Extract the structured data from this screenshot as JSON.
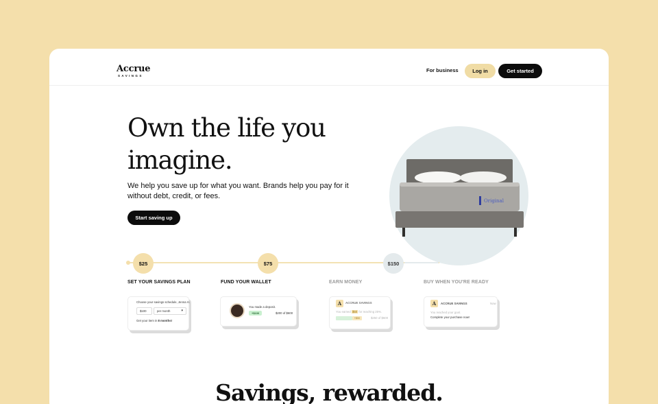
{
  "brand": {
    "name": "Accrue",
    "sub": "SAVINGS"
  },
  "nav": {
    "business": "For business",
    "login": "Log in",
    "get_started": "Get started"
  },
  "hero": {
    "line1": "Own the life you",
    "line2": "imagine.",
    "subtitle": "We help you save up for what you want. Brands help you pay for it without debt, credit, or fees.",
    "cta": "Start saving up",
    "product_label": "Original"
  },
  "timeline": {
    "amounts": [
      "$25",
      "$75",
      "$150"
    ],
    "steps": [
      "SET YOUR SAVINGS PLAN",
      "FUND YOUR WALLET",
      "EARN MONEY",
      "BUY WHEN YOU'RE READY"
    ]
  },
  "card_plan": {
    "prompt": "Choose your savings schedule, Jenna H.",
    "amount": "$100",
    "frequency": "per month",
    "result_prefix": "Get your item in ",
    "result_bold": "8 months!"
  },
  "card_wallet": {
    "message": "You made a deposit.",
    "deposit": "+$100",
    "progress": "$200 of $600"
  },
  "card_earn": {
    "brand": "ACCRUE SAVINGS",
    "message_pre": "You earned ",
    "amount": "$50",
    "message_post": " for reaching 25%.",
    "badge": "+$50",
    "progress": "$250 of $600"
  },
  "card_buy": {
    "brand": "ACCRUE SAVINGS",
    "time": "Now",
    "line1": "You reached your goal.",
    "line2": "Complete your purchase now!"
  },
  "section2": {
    "title": "Savings, rewarded."
  },
  "colors": {
    "background": "#f4dfab",
    "accent": "#f0dca5",
    "dark": "#0c0c0c",
    "circle": "#e4ecee"
  }
}
